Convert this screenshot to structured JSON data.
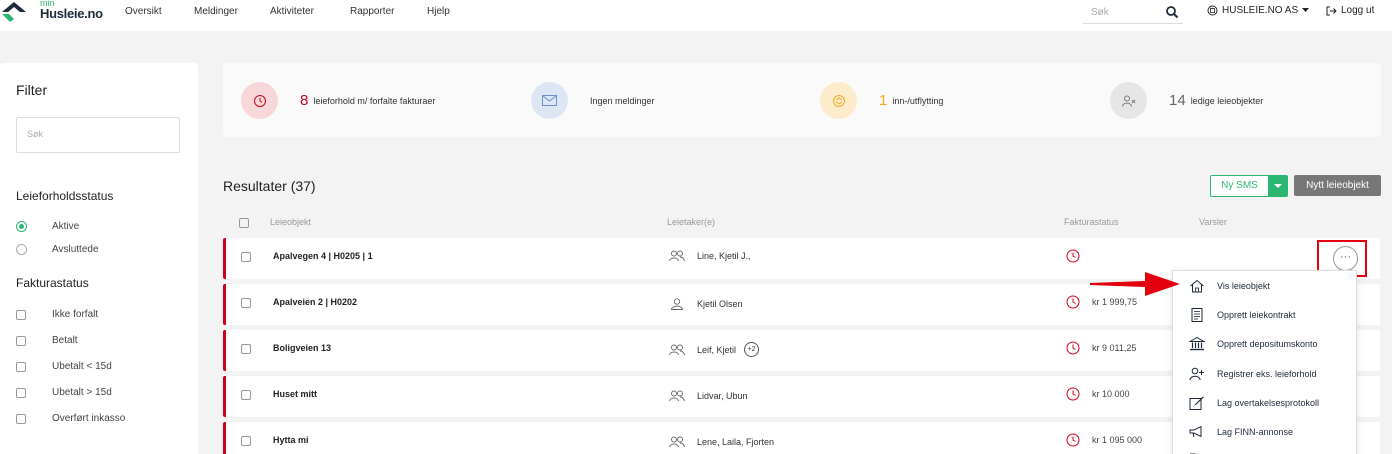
{
  "brand": {
    "small": "min",
    "name": "Husleie.no"
  },
  "nav": [
    "Oversikt",
    "Meldinger",
    "Aktiviteter",
    "Rapporter",
    "Hjelp"
  ],
  "top_search": {
    "placeholder": "Søk"
  },
  "company": "HUSLEIE.NO AS",
  "logout": "Logg ut",
  "filter": {
    "title": "Filter",
    "search_placeholder": "Søk",
    "status_title": "Leieforholdsstatus",
    "status_options": [
      "Aktive",
      "Avsluttede"
    ],
    "status_selected": "Aktive",
    "invoice_title": "Fakturastatus",
    "invoice_options": [
      "Ikke forfalt",
      "Betalt",
      "Ubetalt < 15d",
      "Ubetalt > 15d",
      "Overført inkasso"
    ]
  },
  "stats": [
    {
      "num": "8",
      "text": "leieforhold m/ forfalte fakturaer",
      "color": "#d0021b",
      "bg": "#f8d7da",
      "icon": "clock-icon"
    },
    {
      "num": "",
      "text": "Ingen meldinger",
      "color": "#6f8fc7",
      "bg": "#dde6f3",
      "icon": "mail-icon"
    },
    {
      "num": "1",
      "text": "inn-/utflytting",
      "color": "#f5a623",
      "bg": "#fdeccc",
      "icon": "move-icon"
    },
    {
      "num": "14",
      "text": "ledige leieobjekter",
      "color": "#666666",
      "bg": "#e6e6e6",
      "icon": "person-x-icon"
    }
  ],
  "results": {
    "title": "Resultater (37)",
    "sms_label": "Ny SMS",
    "new_label": "Nytt leieobjekt",
    "headers": [
      "Leieobjekt",
      "Leietaker(e)",
      "Fakturastatus",
      "Varsler"
    ],
    "rows": [
      {
        "object": "Apalvegen 4 | H0205 | 1",
        "tenants": "Line, Kjetil J.,",
        "tenant_icon": "people-icon",
        "extra": "",
        "amount": ""
      },
      {
        "object": "Apalveien 2 | H0202",
        "tenants": "Kjetil Olsen",
        "tenant_icon": "person-icon",
        "extra": "",
        "amount": "kr 1 999,75"
      },
      {
        "object": "Boligveien 13",
        "tenants": "Leif, Kjetil",
        "tenant_icon": "people-icon",
        "extra": "+2",
        "amount": "kr 9 011,25"
      },
      {
        "object": "Huset mitt",
        "tenants": "Lidvar, Ubun",
        "tenant_icon": "people-icon",
        "extra": "",
        "amount": "kr 10 000"
      },
      {
        "object": "Hytta mi",
        "tenants": "Lene, Laila, Fjorten",
        "tenant_icon": "people-icon",
        "extra": "",
        "amount": "kr 1 095 000"
      }
    ]
  },
  "more_button": "···",
  "menu": [
    {
      "label": "Vis leieobjekt",
      "icon": "home-icon"
    },
    {
      "label": "Opprett leiekontrakt",
      "icon": "document-icon"
    },
    {
      "label": "Opprett depositumskonto",
      "icon": "bank-icon"
    },
    {
      "label": "Registrer eks. leieforhold",
      "icon": "person-add-icon"
    },
    {
      "label": "Lag overtakelsesprotokoll",
      "icon": "edit-icon"
    },
    {
      "label": "Lag FINN-annonse",
      "icon": "megaphone-icon"
    }
  ],
  "colors": {
    "accent": "#2bb673",
    "alert": "#d0021b",
    "highlight": "#e3000f"
  }
}
